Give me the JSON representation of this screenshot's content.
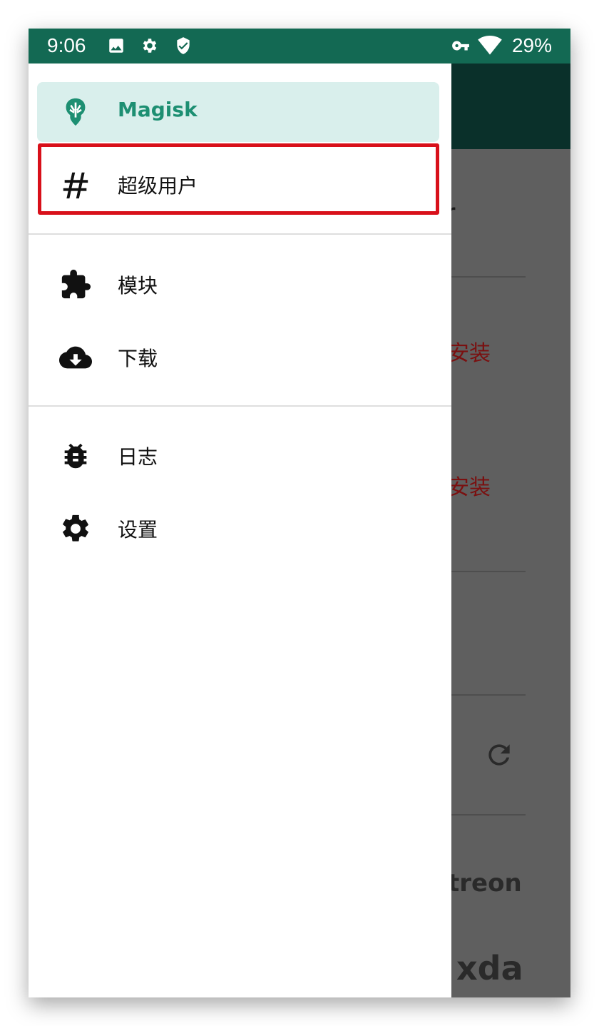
{
  "status_bar": {
    "time": "9:06",
    "battery": "29%",
    "icons": [
      "image-icon",
      "gear-icon",
      "shield-check-icon",
      "vpn-key-icon",
      "wifi-icon"
    ]
  },
  "colors": {
    "status_bar": "#136953",
    "accent": "#1d8f72",
    "active_bg": "#d9efec",
    "highlight_border": "#d8101a"
  },
  "drawer": {
    "items": [
      {
        "label": "Magisk",
        "icon": "magisk-icon",
        "active": true
      },
      {
        "label": "超级用户",
        "icon": "hash-icon",
        "active": false,
        "highlighted": true
      },
      {
        "label": "模块",
        "icon": "puzzle-icon",
        "active": false
      },
      {
        "label": "下载",
        "icon": "cloud-download-icon",
        "active": false
      },
      {
        "label": "日志",
        "icon": "bug-icon",
        "active": false
      },
      {
        "label": "设置",
        "icon": "gear-icon",
        "active": false
      }
    ]
  },
  "background_app": {
    "title_fragment": "er",
    "install_labels": [
      "安装",
      "安装"
    ],
    "patreon_fragment": "treon",
    "xda_fragment": "xda"
  }
}
